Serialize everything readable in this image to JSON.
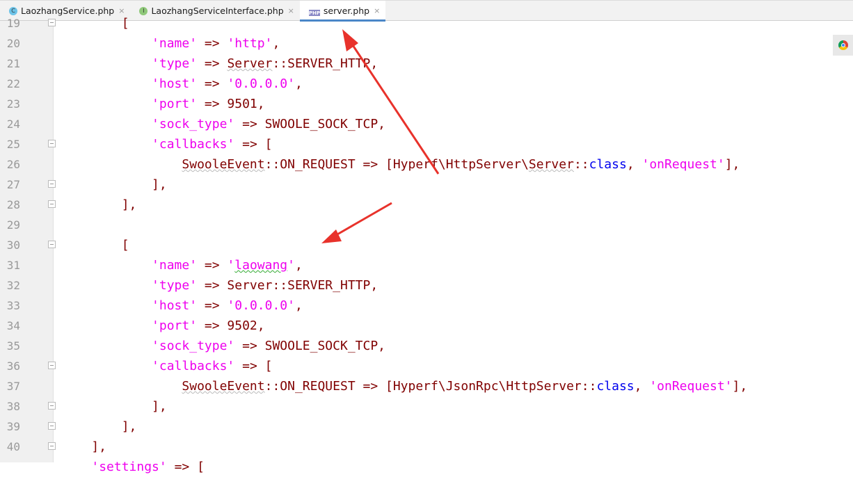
{
  "tabs": [
    {
      "label": "LaozhangService.php",
      "icon": "C",
      "active": false
    },
    {
      "label": "LaozhangServiceInterface.php",
      "icon": "I",
      "active": false
    },
    {
      "label": "server.php",
      "icon": "PHP",
      "active": true
    }
  ],
  "close_glyph": "×",
  "colors": {
    "key": "#ee00ee",
    "default": "#800000",
    "keyword": "#0000ee",
    "accent": "#4a86c8",
    "arrow": "#e8322b"
  },
  "lines": [
    {
      "n": "19",
      "fold": true,
      "code": [
        [
          "",
          "        ["
        ]
      ]
    },
    {
      "n": "20",
      "code": [
        [
          "",
          "            "
        ],
        [
          "k",
          "'name'"
        ],
        [
          "",
          " => "
        ],
        [
          "k",
          "'http'"
        ],
        [
          "",
          ","
        ]
      ]
    },
    {
      "n": "21",
      "code": [
        [
          "",
          "            "
        ],
        [
          "k",
          "'type'"
        ],
        [
          "",
          " => "
        ],
        [
          "u",
          "Server"
        ],
        [
          "",
          "::SERVER_HTTP,"
        ]
      ]
    },
    {
      "n": "22",
      "code": [
        [
          "",
          "            "
        ],
        [
          "k",
          "'host'"
        ],
        [
          "",
          " => "
        ],
        [
          "k",
          "'0.0.0.0'"
        ],
        [
          "",
          ","
        ]
      ]
    },
    {
      "n": "23",
      "code": [
        [
          "",
          "            "
        ],
        [
          "k",
          "'port'"
        ],
        [
          "",
          " => 9501,"
        ]
      ]
    },
    {
      "n": "24",
      "code": [
        [
          "",
          "            "
        ],
        [
          "k",
          "'sock_type'"
        ],
        [
          "",
          " => SWOOLE_SOCK_TCP,"
        ]
      ]
    },
    {
      "n": "25",
      "fold": true,
      "code": [
        [
          "",
          "            "
        ],
        [
          "k",
          "'callbacks'"
        ],
        [
          "",
          " => ["
        ]
      ]
    },
    {
      "n": "26",
      "code": [
        [
          "",
          "                "
        ],
        [
          "u",
          "SwooleEvent"
        ],
        [
          "",
          "::ON_REQUEST => [Hyperf\\HttpServer\\"
        ],
        [
          "u",
          "Server"
        ],
        [
          "",
          "::"
        ],
        [
          "b",
          "class"
        ],
        [
          "",
          ", "
        ],
        [
          "k",
          "'onRequest'"
        ],
        [
          "",
          "],"
        ]
      ]
    },
    {
      "n": "27",
      "fold": true,
      "code": [
        [
          "",
          "            ],"
        ]
      ]
    },
    {
      "n": "28",
      "fold": true,
      "code": [
        [
          "",
          "        ],"
        ]
      ]
    },
    {
      "n": "29",
      "code": []
    },
    {
      "n": "30",
      "fold": true,
      "code": [
        [
          "",
          "        ["
        ]
      ]
    },
    {
      "n": "31",
      "code": [
        [
          "",
          "            "
        ],
        [
          "k",
          "'name'"
        ],
        [
          "",
          " => "
        ],
        [
          "k",
          "'"
        ],
        [
          "kg",
          "laowang"
        ],
        [
          "k",
          "'"
        ],
        [
          "",
          ","
        ]
      ]
    },
    {
      "n": "32",
      "code": [
        [
          "",
          "            "
        ],
        [
          "k",
          "'type'"
        ],
        [
          "",
          " => Server::SERVER_HTTP,"
        ]
      ]
    },
    {
      "n": "33",
      "code": [
        [
          "",
          "            "
        ],
        [
          "k",
          "'host'"
        ],
        [
          "",
          " => "
        ],
        [
          "k",
          "'0.0.0.0'"
        ],
        [
          "",
          ","
        ]
      ]
    },
    {
      "n": "34",
      "code": [
        [
          "",
          "            "
        ],
        [
          "k",
          "'port'"
        ],
        [
          "",
          " => 9502,"
        ]
      ]
    },
    {
      "n": "35",
      "code": [
        [
          "",
          "            "
        ],
        [
          "k",
          "'sock_type'"
        ],
        [
          "",
          " => SWOOLE_SOCK_TCP,"
        ]
      ]
    },
    {
      "n": "36",
      "fold": true,
      "code": [
        [
          "",
          "            "
        ],
        [
          "k",
          "'callbacks'"
        ],
        [
          "",
          " => ["
        ]
      ]
    },
    {
      "n": "37",
      "code": [
        [
          "",
          "                "
        ],
        [
          "u",
          "SwooleEvent"
        ],
        [
          "",
          "::ON_REQUEST => [Hyperf\\JsonRpc\\HttpServer::"
        ],
        [
          "b",
          "class"
        ],
        [
          "",
          ", "
        ],
        [
          "k",
          "'onRequest'"
        ],
        [
          "",
          "],"
        ]
      ]
    },
    {
      "n": "38",
      "fold": true,
      "code": [
        [
          "",
          "            ],"
        ]
      ]
    },
    {
      "n": "39",
      "fold": true,
      "code": [
        [
          "",
          "        ],"
        ]
      ]
    },
    {
      "n": "40",
      "fold": true,
      "code": [
        [
          "",
          "    ],"
        ]
      ]
    },
    {
      "n": "",
      "code": [
        [
          "",
          "    "
        ],
        [
          "k",
          "'settings'"
        ],
        [
          "",
          " => ["
        ]
      ]
    }
  ]
}
